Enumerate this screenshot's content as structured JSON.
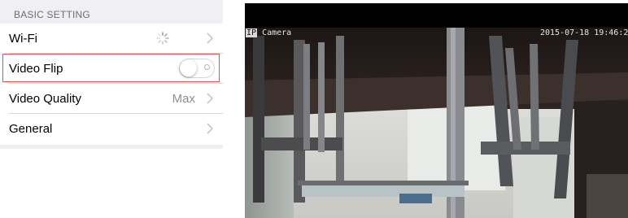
{
  "settings": {
    "section_title": "BASIC SETTING",
    "rows": [
      {
        "label": "Wi-Fi",
        "accessory": "spinner-icon"
      },
      {
        "label": "Video Flip",
        "accessory": "toggle",
        "toggle_on": false,
        "highlighted": true
      },
      {
        "label": "Video Quality",
        "value": "Max",
        "accessory": "chevron-right-icon"
      },
      {
        "label": "General",
        "accessory": "chevron-right-icon"
      }
    ]
  },
  "camera": {
    "badge": "IP",
    "label": "Camera",
    "timestamp": "2015-07-18 19:46:2"
  },
  "colors": {
    "highlight_border": "#d9534f",
    "section_background": "#efeff4",
    "secondary_text": "#8e8e93"
  }
}
